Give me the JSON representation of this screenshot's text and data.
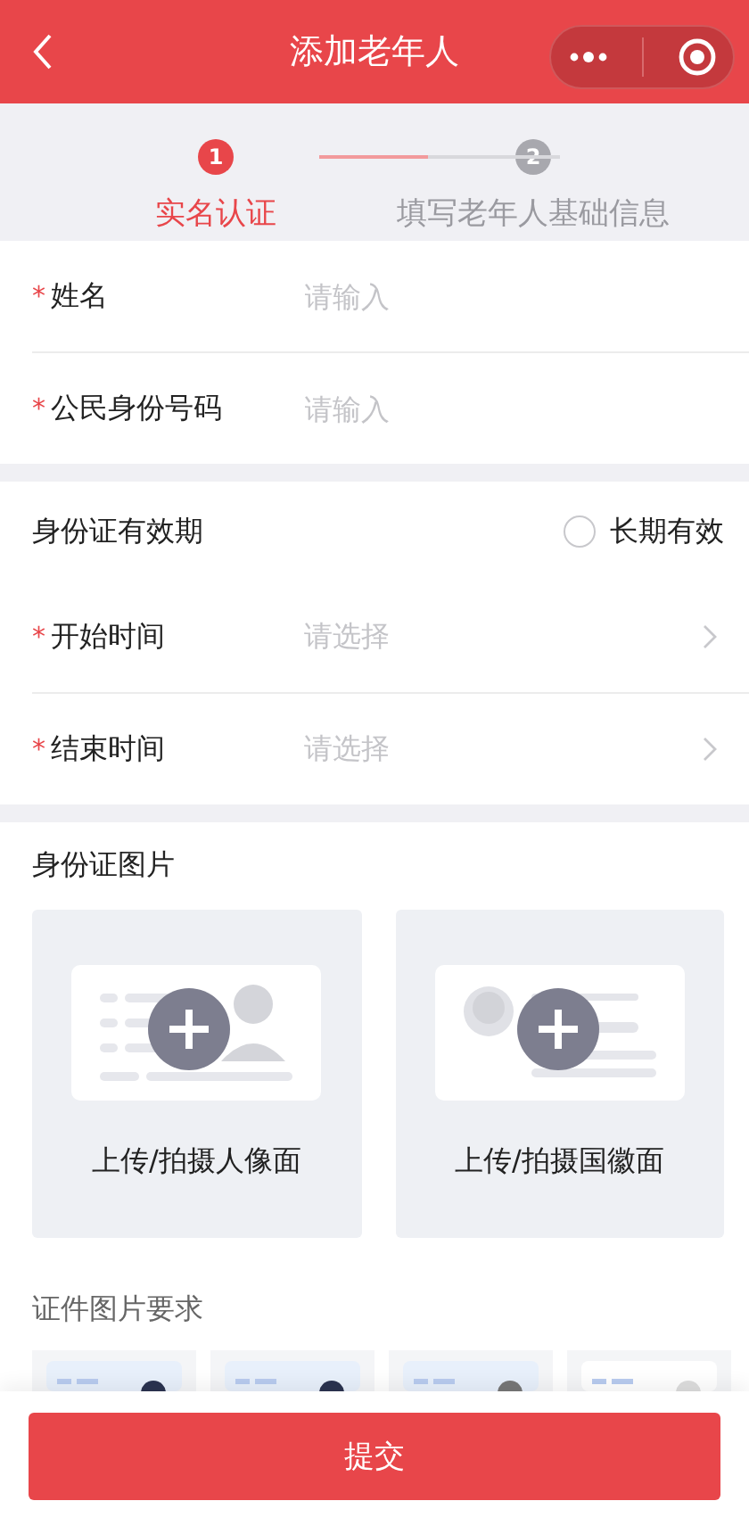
{
  "header": {
    "title": "添加老年人"
  },
  "steps": [
    {
      "number": "1",
      "label": "实名认证",
      "selected": true
    },
    {
      "number": "2",
      "label": "填写老年人基础信息",
      "selected": false
    }
  ],
  "step_progress": {
    "level": 0.45
  },
  "fields": [
    {
      "label": "姓名",
      "required_mark": "*",
      "placeholder": "请输入"
    },
    {
      "label": "公民身份号码",
      "required_mark": "*",
      "placeholder": "请输入"
    }
  ],
  "validity": {
    "label": "身份证有效期",
    "option": {
      "label": "长期有效",
      "checked": false
    }
  },
  "date_fields": [
    {
      "label": "开始时间",
      "required_mark": "*",
      "placeholder": "请选择"
    },
    {
      "label": "结束时间",
      "required_mark": "*",
      "placeholder": "请选择"
    }
  ],
  "id_photos": {
    "title": "身份证图片",
    "cards": [
      {
        "kind": "portrait",
        "label": "上传/拍摄人像面"
      },
      {
        "kind": "emblem",
        "label": "上传/拍摄国徽面"
      }
    ]
  },
  "requirements": {
    "title": "证件图片要求"
  },
  "submit": {
    "label": "提交"
  }
}
